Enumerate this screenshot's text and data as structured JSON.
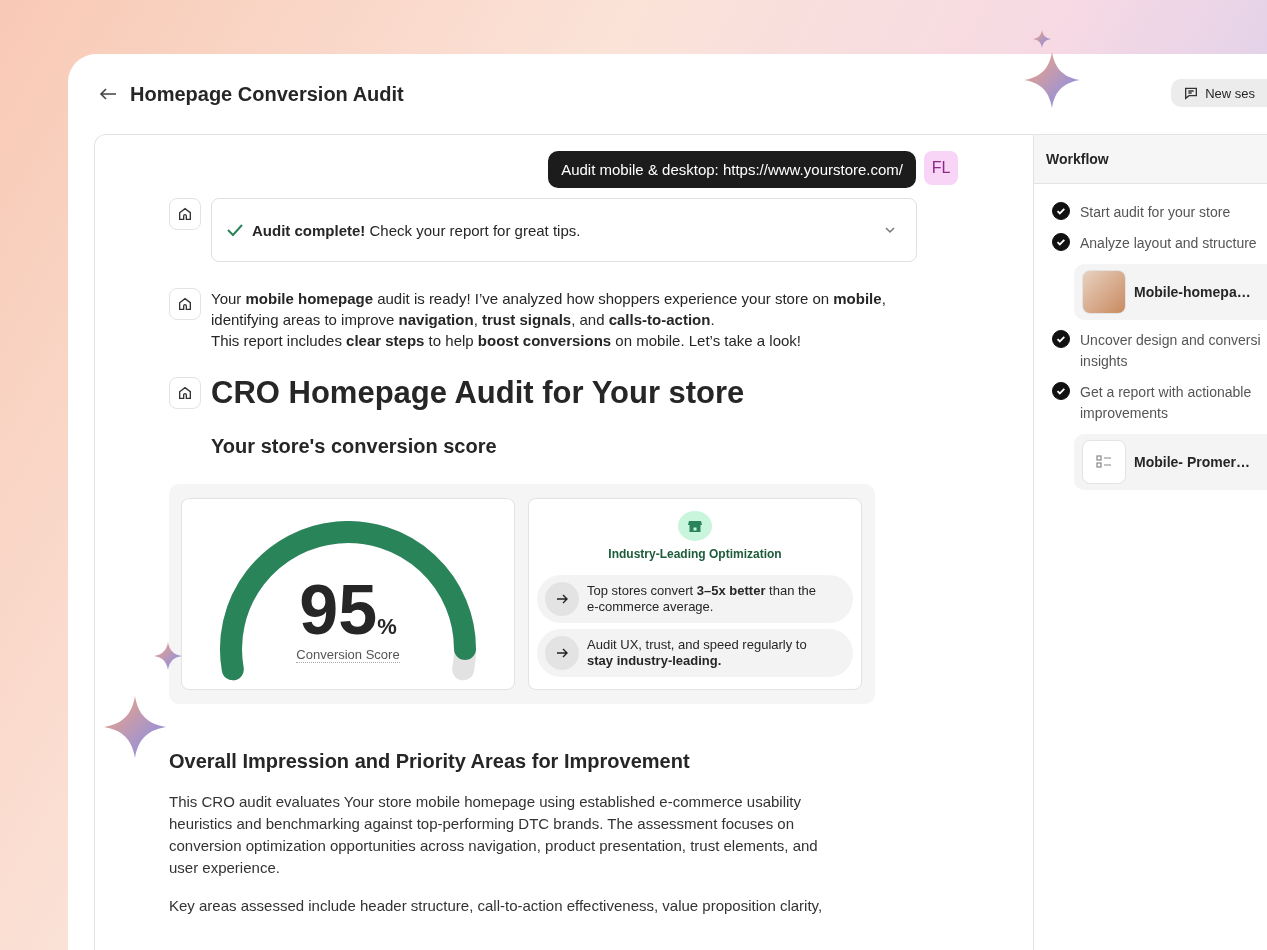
{
  "header": {
    "title": "Homepage Conversion Audit",
    "new_session": "New ses"
  },
  "chat": {
    "user_message": "Audit mobile & desktop: https://www.yourstore.com/",
    "user_initials": "FL",
    "status": {
      "text": "**Audit complete!** Check your report for great tips.",
      "expanded": false
    },
    "intro": [
      "Your **mobile homepage** audit is ready! I’ve analyzed how shoppers experience your store on **mobile**, identifying areas to improve **navigation**, **trust signals**, and **calls-to-action**.",
      "This report includes **clear steps** to help **boost conversions** on mobile. Let’s take a look!"
    ],
    "report_title": "CRO Homepage Audit for Your store",
    "score_heading": "Your store's conversion score",
    "score": {
      "value": "95",
      "unit": "%",
      "label": "Conversion Score",
      "level": 0.95
    },
    "insight": {
      "title": "Industry-Leading Optimization",
      "tips": [
        "Top stores convert **3–5x better** than the e-commerce average.",
        "Audit UX, trust, and speed regularly to **stay industry-leading.**"
      ]
    },
    "section_heading": "Overall Impression and Priority Areas for Improvement",
    "paragraphs": [
      "This CRO audit evaluates Your store mobile homepage using established e-commerce usability heuristics and benchmarking against top-performing DTC brands. The assessment focuses on conversion optimization opportunities across navigation, product presentation, trust elements, and user experience.",
      "Key areas assessed include header structure, call-to-action effectiveness, value proposition clarity,"
    ]
  },
  "workflow": {
    "title": "Workflow",
    "steps": [
      {
        "label": "Start audit for your store",
        "done": true
      },
      {
        "label": "Analyze layout and structure",
        "done": true,
        "attachment": {
          "kind": "image",
          "name": "Mobile-homepa…"
        }
      },
      {
        "label": "Uncover design and conversi insights",
        "done": true
      },
      {
        "label": "Get a report with actionable improvements",
        "done": true,
        "attachment": {
          "kind": "list",
          "name": "Mobile- Promer…"
        }
      }
    ]
  }
}
